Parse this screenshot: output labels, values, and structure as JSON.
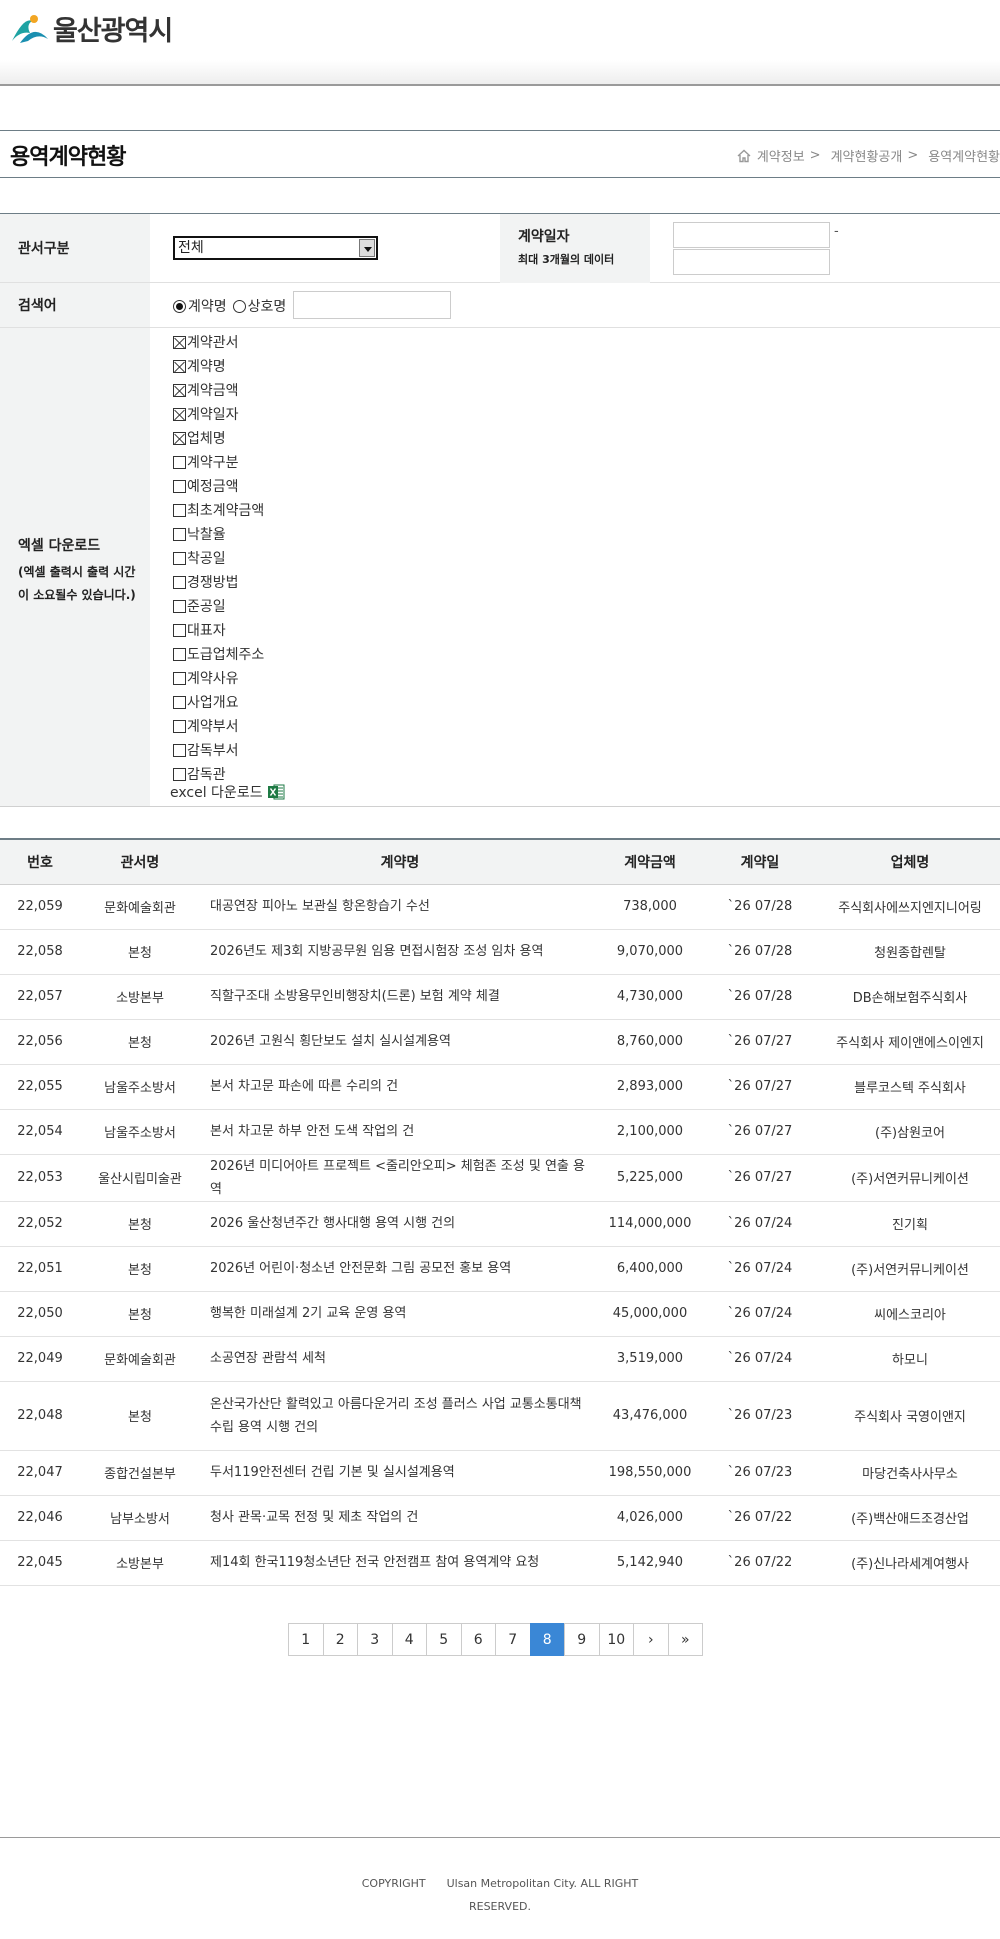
{
  "header": {
    "logo_text": "울산광역시"
  },
  "page": {
    "title": "용역계약현황",
    "breadcrumb": [
      "계약정보",
      "계약현황공개",
      "용역계약현황"
    ],
    "breadcrumb_sep": ">"
  },
  "search": {
    "office_label": "관서구분",
    "office_selected": "전체",
    "date_label": "계약일자",
    "date_note": "최대 3개월의 데이터",
    "date_from": "",
    "date_to": "",
    "date_dash": "-",
    "keyword_label": "검색어",
    "radio_options": [
      {
        "label": "계약명",
        "checked": true
      },
      {
        "label": "상호명",
        "checked": false
      }
    ],
    "keyword_value": "",
    "excel_label": "엑셀 다운로드",
    "excel_note_1": "(엑셀 출력시 출력 시간",
    "excel_note_2": "이 소요될수 있습니다.)",
    "excel_fields": [
      {
        "label": "계약관서",
        "checked": true
      },
      {
        "label": "계약명",
        "checked": true
      },
      {
        "label": "계약금액",
        "checked": true
      },
      {
        "label": "계약일자",
        "checked": true
      },
      {
        "label": "업체명",
        "checked": true
      },
      {
        "label": "계약구분",
        "checked": false
      },
      {
        "label": "예정금액",
        "checked": false
      },
      {
        "label": "최초계약금액",
        "checked": false
      },
      {
        "label": "낙찰율",
        "checked": false
      },
      {
        "label": "착공일",
        "checked": false
      },
      {
        "label": "경쟁방법",
        "checked": false
      },
      {
        "label": "준공일",
        "checked": false
      },
      {
        "label": "대표자",
        "checked": false
      },
      {
        "label": "도급업체주소",
        "checked": false
      },
      {
        "label": "계약사유",
        "checked": false
      },
      {
        "label": "사업개요",
        "checked": false
      },
      {
        "label": "계약부서",
        "checked": false
      },
      {
        "label": "감독부서",
        "checked": false
      },
      {
        "label": "감독관",
        "checked": false
      }
    ],
    "excel_download_label": "excel 다운로드"
  },
  "table": {
    "headers": [
      "번호",
      "관서명",
      "계약명",
      "계약금액",
      "계약일",
      "업체명"
    ],
    "rows": [
      [
        "22,059",
        "문화예술회관",
        "대공연장 피아노 보관실 항온항습기 수선",
        "738,000",
        "`26 07/28",
        "주식회사에쓰지엔지니어링"
      ],
      [
        "22,058",
        "본청",
        "2026년도 제3회 지방공무원 임용 면접시험장 조성 임차 용역",
        "9,070,000",
        "`26 07/28",
        "청원종합렌탈"
      ],
      [
        "22,057",
        "소방본부",
        "직할구조대 소방용무인비행장치(드론) 보험 계약 체결",
        "4,730,000",
        "`26 07/28",
        "DB손해보험주식회사"
      ],
      [
        "22,056",
        "본청",
        "2026년 고원식 횡단보도 설치 실시설계용역",
        "8,760,000",
        "`26 07/27",
        "주식회사 제이앤에스이엔지"
      ],
      [
        "22,055",
        "남울주소방서",
        "본서 차고문 파손에 따른 수리의 건",
        "2,893,000",
        "`26 07/27",
        "블루코스텍 주식회사"
      ],
      [
        "22,054",
        "남울주소방서",
        "본서 차고문 하부 안전 도색 작업의 건",
        "2,100,000",
        "`26 07/27",
        "(주)삼원코어"
      ],
      [
        "22,053",
        "울산시립미술관",
        "2026년 미디어아트 프로젝트 <줄리안오피> 체험존 조성 및 연출 용역",
        "5,225,000",
        "`26 07/27",
        "(주)서연커뮤니케이션"
      ],
      [
        "22,052",
        "본청",
        "2026 울산청년주간 행사대행 용역 시행 건의",
        "114,000,000",
        "`26 07/24",
        "진기획"
      ],
      [
        "22,051",
        "본청",
        "2026년 어린이·청소년 안전문화 그림 공모전 홍보 용역",
        "6,400,000",
        "`26 07/24",
        "(주)서연커뮤니케이션"
      ],
      [
        "22,050",
        "본청",
        "행복한 미래설계 2기 교육 운영 용역",
        "45,000,000",
        "`26 07/24",
        "씨에스코리아"
      ],
      [
        "22,049",
        "문화예술회관",
        "소공연장 관람석 세척",
        "3,519,000",
        "`26 07/24",
        "하모니"
      ],
      [
        "22,048",
        "본청",
        "온산국가산단 활력있고 아름다운거리 조성 플러스 사업 교통소통대책수립 용역 시행 건의",
        "43,476,000",
        "`26 07/23",
        "주식회사 국영이앤지"
      ],
      [
        "22,047",
        "종합건설본부",
        "두서119안전센터 건립 기본 및 실시설계용역",
        "198,550,000",
        "`26 07/23",
        "마당건축사사무소"
      ],
      [
        "22,046",
        "남부소방서",
        "청사 관목·교목 전정 및 제초 작업의 건",
        "4,026,000",
        "`26 07/22",
        "(주)백산애드조경산업"
      ],
      [
        "22,045",
        "소방본부",
        "제14회 한국119청소년단 전국 안전캠프 참여 용역계약 요청",
        "5,142,940",
        "`26 07/22",
        "(주)신나라세계여행사"
      ]
    ]
  },
  "pagination": {
    "pages": [
      "1",
      "2",
      "3",
      "4",
      "5",
      "6",
      "7",
      "8",
      "9",
      "10"
    ],
    "current": "8",
    "next": "›",
    "last": "»"
  },
  "footer": {
    "copyright_line1": "COPYRIGHT      Ulsan Metropolitan City. ALL RIGHT",
    "copyright_line2": "RESERVED."
  },
  "colors": {
    "accent": "#3a87d6",
    "header_bg": "#f2f3f3",
    "logo_teal": "#1ea3a3"
  }
}
